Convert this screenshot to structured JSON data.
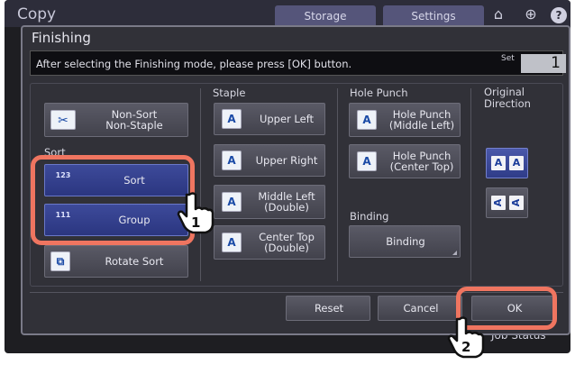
{
  "app": {
    "title": "Copy",
    "tabs": [
      {
        "label": "Storage"
      },
      {
        "label": "Settings"
      }
    ],
    "icons": [
      "home-icon",
      "globe-icon",
      "help-icon"
    ],
    "help_label": "?",
    "job_status": "Job Status"
  },
  "dialog": {
    "title": "Finishing",
    "message": "After selecting the Finishing mode, please press [OK] button.",
    "set_label": "Set",
    "set_value": "1"
  },
  "sort": {
    "section_label": "Sort",
    "non_sort": {
      "label1": "Non-Sort",
      "label2": "Non-Staple",
      "icon": "non-sort-icon"
    },
    "sort_btn": {
      "label": "Sort",
      "icon": "sort-icon",
      "icon_text": "123"
    },
    "group_btn": {
      "label": "Group",
      "icon": "group-icon",
      "icon_text": "111"
    },
    "rotate_btn": {
      "label": "Rotate Sort",
      "icon": "rotate-sort-icon"
    }
  },
  "staple": {
    "section_label": "Staple",
    "upper_left": {
      "label": "Upper Left",
      "icon_text": "A"
    },
    "upper_right": {
      "label": "Upper Right",
      "icon_text": "A"
    },
    "middle_left": {
      "label1": "Middle Left",
      "label2": "(Double)",
      "icon_text": "A"
    },
    "center_top": {
      "label1": "Center Top",
      "label2": "(Double)",
      "icon_text": "A"
    }
  },
  "hole_punch": {
    "section_label": "Hole Punch",
    "middle_left": {
      "label1": "Hole Punch",
      "label2": "(Middle Left)",
      "icon_text": "A"
    },
    "center_top": {
      "label1": "Hole Punch",
      "label2": "(Center Top)",
      "icon_text": "A"
    }
  },
  "binding": {
    "section_label": "Binding",
    "button_label": "Binding"
  },
  "original_direction": {
    "label1": "Original",
    "label2": "Direction",
    "portrait": {
      "g1": "A",
      "g2": "A"
    },
    "landscape": {
      "g1": "A",
      "g2": "A"
    }
  },
  "actions": {
    "reset": "Reset",
    "cancel": "Cancel",
    "ok": "OK"
  },
  "callouts": [
    {
      "number": "1"
    },
    {
      "number": "2"
    }
  ],
  "colors": {
    "accent_blue": "#2b3680",
    "highlight": "#ef7560"
  }
}
